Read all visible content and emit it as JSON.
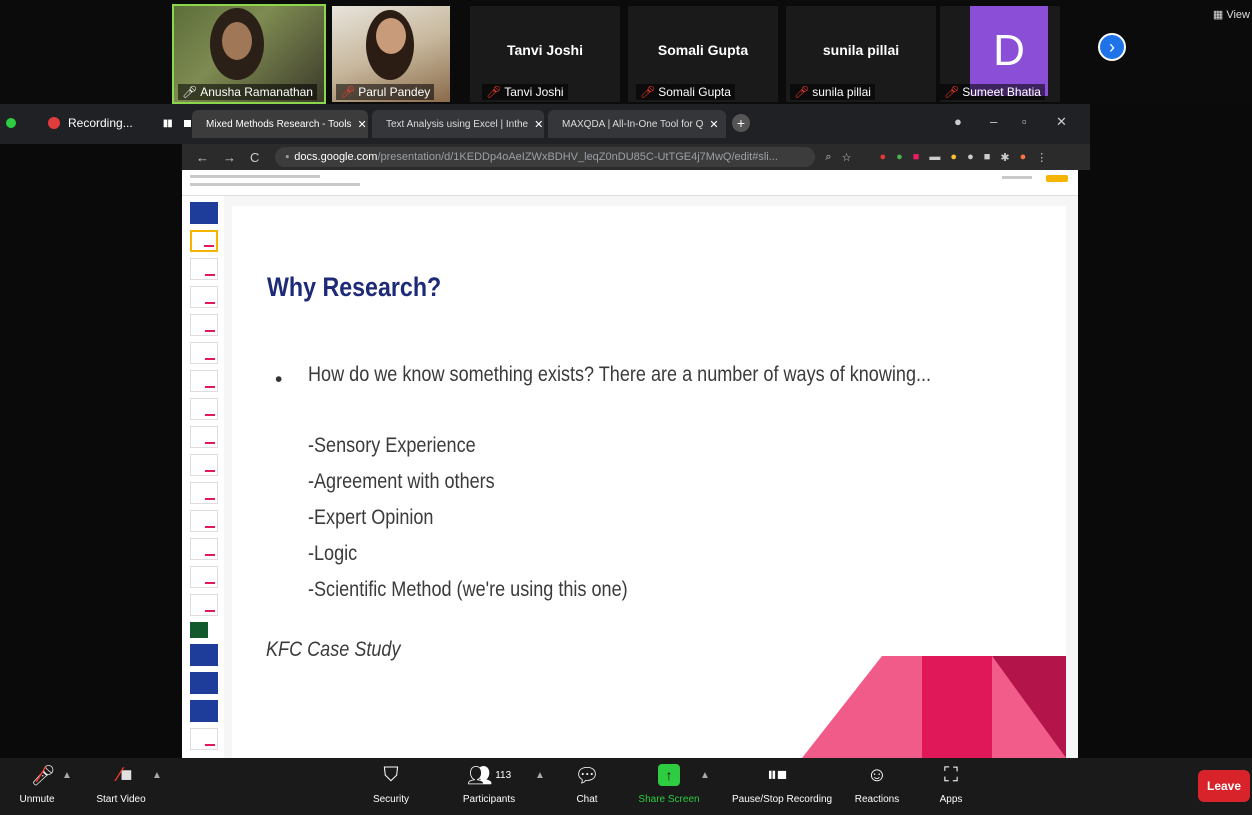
{
  "participants": [
    {
      "name": "Anusha Ramanathan",
      "video": true,
      "speaking": true
    },
    {
      "name": "Parul Pandey",
      "video": true,
      "muted": true
    },
    {
      "name": "Tanvi Joshi",
      "video": false,
      "muted": true
    },
    {
      "name": "Somali Gupta",
      "video": false,
      "muted": true
    },
    {
      "name": "sunila pillai",
      "video": false,
      "muted": true
    },
    {
      "name": "Sumeet Bhatia",
      "video": false,
      "muted": true,
      "avatar_letter": "D"
    }
  ],
  "view_label": "View",
  "recording": {
    "label": "Recording..."
  },
  "browser": {
    "tabs": [
      {
        "title": "Mixed Methods Research - Tools",
        "active": true
      },
      {
        "title": "Text Analysis using Excel | Inthe",
        "active": false
      },
      {
        "title": "MAXQDA | All-In-One Tool for Q",
        "active": false
      }
    ],
    "url_host": "docs.google.com",
    "url_path": "/presentation/d/1KEDDp4oAeIZWxBDHV_leqZ0nDU85C-UtTGE4j7MwQ/edit#sli..."
  },
  "slide": {
    "title": "Why Research?",
    "bullet": "How do we know something exists? There are a number of ways of knowing...",
    "sub_items": [
      "-Sensory Experience",
      "-Agreement with others",
      "-Expert Opinion",
      "-Logic",
      "-Scientific Method (we're using this one)"
    ],
    "footer": "KFC Case Study"
  },
  "toolbar": {
    "unmute": "Unmute",
    "start_video": "Start Video",
    "security": "Security",
    "participants": "Participants",
    "participants_count": "113",
    "chat": "Chat",
    "share_screen": "Share Screen",
    "pause_stop": "Pause/Stop Recording",
    "reactions": "Reactions",
    "apps": "Apps",
    "leave": "Leave"
  },
  "colors": {
    "slide_title": "#1d2a78",
    "accent_pink": "#e2175d",
    "share_green": "#2ecc40",
    "leave_red": "#d8232a"
  }
}
